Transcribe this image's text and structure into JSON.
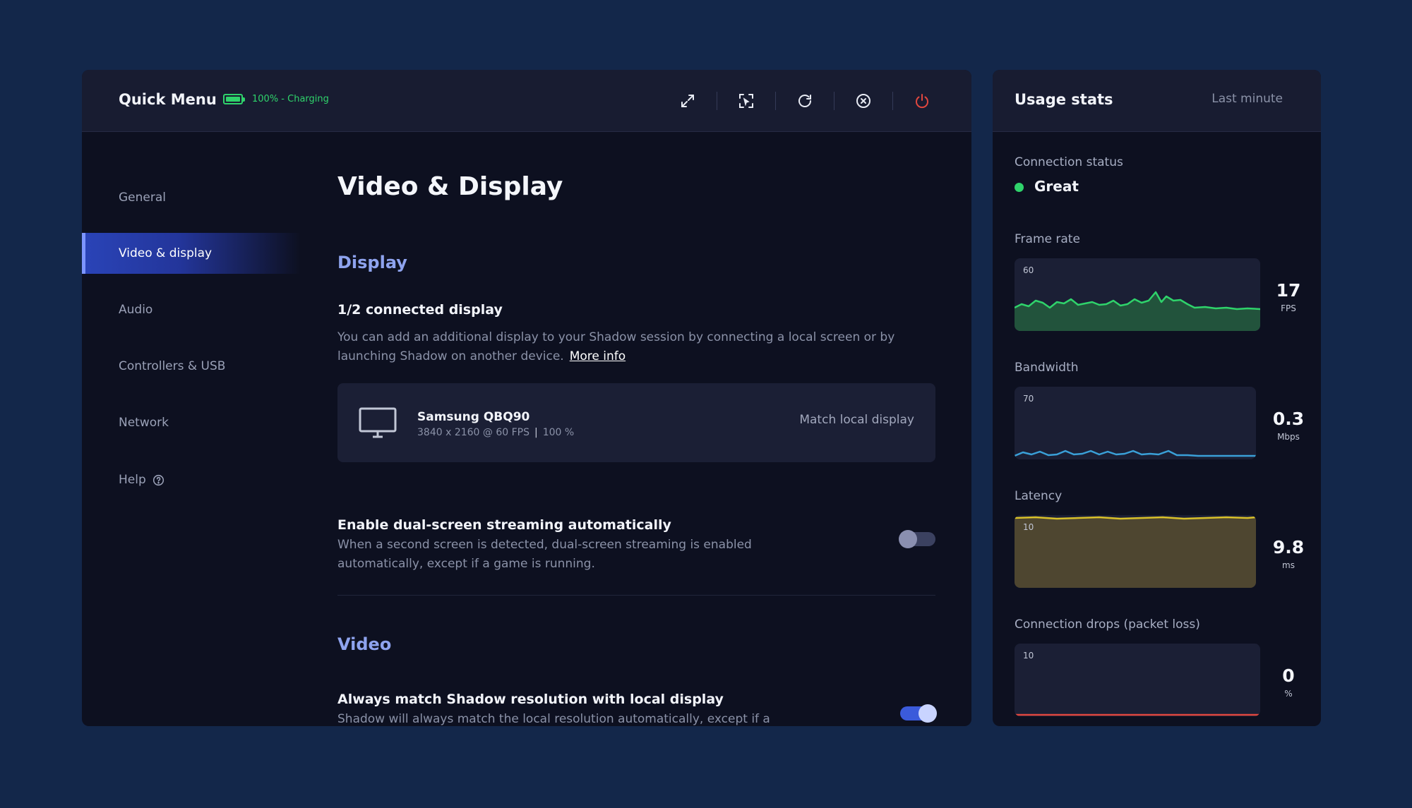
{
  "header": {
    "title": "Quick Menu",
    "battery_text": "100% - Charging",
    "battery_level": 1.0,
    "tools": [
      "fullscreen-icon",
      "screenshot-icon",
      "refresh-icon",
      "close-session-icon",
      "power-icon"
    ]
  },
  "sidebar": {
    "items": [
      {
        "label": "General"
      },
      {
        "label": "Video & display",
        "active": true
      },
      {
        "label": "Audio"
      },
      {
        "label": "Controllers & USB"
      },
      {
        "label": "Network"
      },
      {
        "label": "Help"
      }
    ]
  },
  "content": {
    "page_title": "Video & Display",
    "display_section": "Display",
    "connected_title": "1/2 connected display",
    "connected_desc_line1": "You can add an additional display to your Shadow session by connecting a local screen or by",
    "connected_desc_line2": "launching Shadow on another device.",
    "more_info": "More info",
    "display_card": {
      "name": "Samsung QBQ90",
      "resolution": "3840 x 2160 @ 60 FPS",
      "scale": "100 %",
      "action": "Match local display"
    },
    "dual_screen": {
      "title": "Enable dual-screen streaming automatically",
      "desc_line1": "When a second screen is detected, dual-screen streaming is enabled",
      "desc_line2": "automatically, except if a game is running.",
      "enabled": false
    },
    "video_section": "Video",
    "match_resolution": {
      "title": "Always match Shadow resolution with local display",
      "desc_line1": "Shadow will always match the local resolution automatically, except if a",
      "enabled": true
    }
  },
  "usage": {
    "title": "Usage stats",
    "range": "Last minute",
    "connection_label": "Connection status",
    "connection_status": "Great",
    "stats": [
      {
        "label": "Frame rate",
        "max": "60",
        "value": "17",
        "unit": "FPS",
        "color": "#2fd36b"
      },
      {
        "label": "Bandwidth",
        "max": "70",
        "value": "0.3",
        "unit": "Mbps",
        "color": "#3aa0d8"
      },
      {
        "label": "Latency",
        "max": "10",
        "value": "9.8",
        "unit": "ms",
        "color": "#d9c12a"
      },
      {
        "label": "Connection drops (packet loss)",
        "max": "10",
        "value": "0",
        "unit": "%",
        "color": "#e0473f"
      }
    ]
  }
}
